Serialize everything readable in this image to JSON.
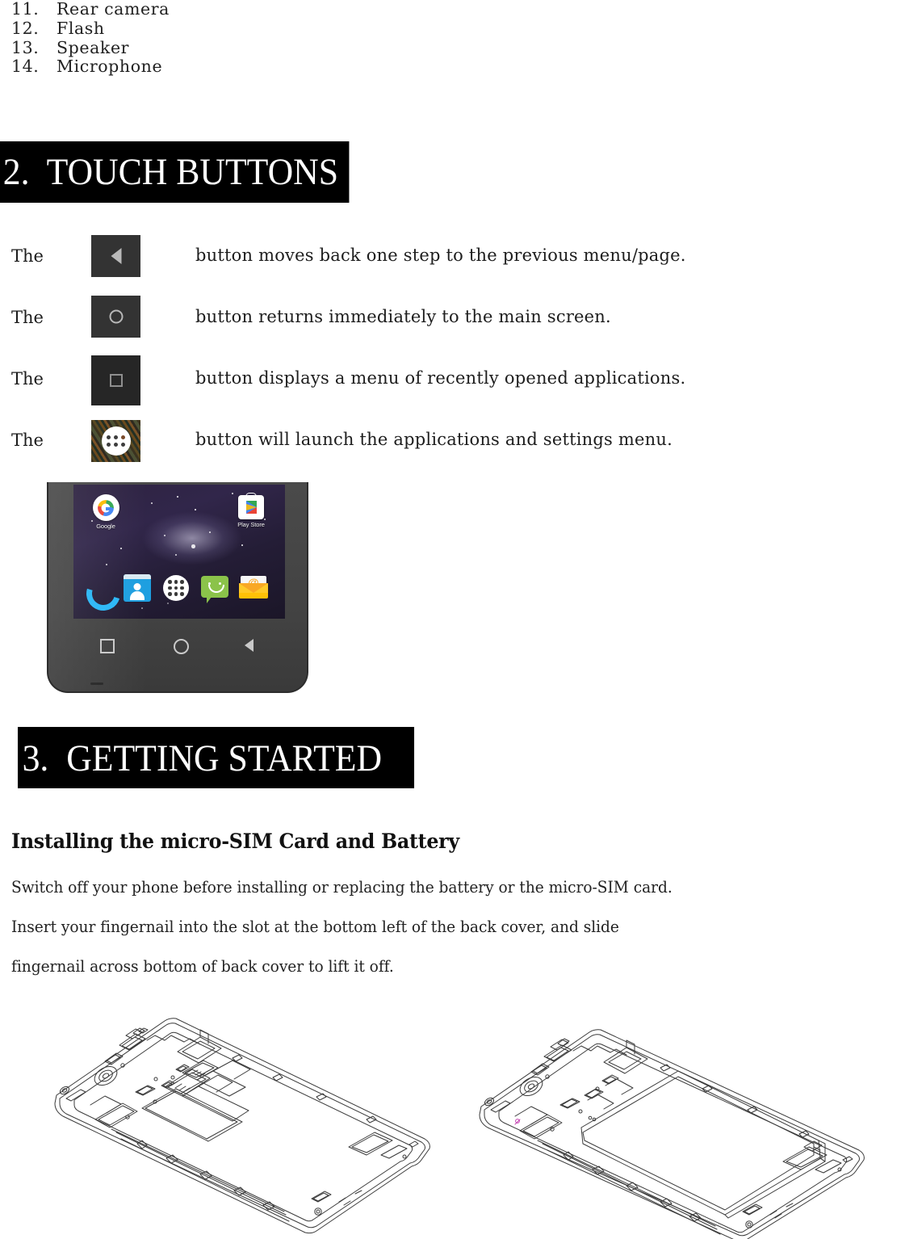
{
  "parts_list": {
    "items": [
      {
        "num": "11.",
        "label": "Rear camera"
      },
      {
        "num": "12.",
        "label": "Flash"
      },
      {
        "num": "13.",
        "label": "Speaker"
      },
      {
        "num": "14.",
        "label": "Microphone"
      }
    ]
  },
  "sections": {
    "touch_buttons": {
      "band_title": "2.  TOUCH BUTTONS",
      "rows": [
        {
          "the": "The",
          "icon": "back-button-icon",
          "description": "button moves back one step to the previous menu/page."
        },
        {
          "the": "The",
          "icon": "home-button-icon",
          "description": "button returns immediately to the main screen."
        },
        {
          "the": "The",
          "icon": "recents-button-icon",
          "description": "button displays a menu of recently opened applications."
        },
        {
          "the": "The",
          "icon": "app-drawer-button-icon",
          "description": "button will launch the applications and settings menu."
        }
      ]
    },
    "getting_started": {
      "band_title": "3.  GETTING STARTED",
      "subheading": "Installing the micro-SIM Card and Battery",
      "body": [
        "Switch off your phone before installing or replacing the battery or the micro-SIM card.",
        "Insert your fingernail into the slot at the bottom left of the back cover, and slide",
        "fingernail across bottom of back cover to lift it off."
      ]
    }
  },
  "phone_photo": {
    "home_screen": {
      "app_icons": [
        {
          "name": "google-search-icon",
          "label": "Google"
        },
        {
          "name": "play-store-icon",
          "label": "Play Store"
        }
      ],
      "dock_icons": [
        "phone-dialer-icon",
        "contacts-icon",
        "app-drawer-icon",
        "messaging-icon",
        "email-icon"
      ]
    },
    "nav_bar_icons": [
      "recents-square-icon",
      "home-circle-icon",
      "back-triangle-icon"
    ]
  },
  "diagrams": [
    {
      "name": "phone-back-cover-removed-sim-slots"
    },
    {
      "name": "phone-back-cover-removed-battery-installed"
    }
  ],
  "colors": {
    "band_background": "#000000",
    "band_text": "#ffffff",
    "body_text": "#222222",
    "button_chip": "#333333",
    "glyph": "#b9b9b9",
    "google_blue": "#4285f4",
    "google_red": "#ea4335",
    "google_yellow": "#fbbc05",
    "google_green": "#34a853",
    "messaging_green": "#8bc34a",
    "email_yellow": "#ffc107",
    "contacts_blue": "#1e9fe0",
    "dialer_blue": "#29b6f6"
  }
}
